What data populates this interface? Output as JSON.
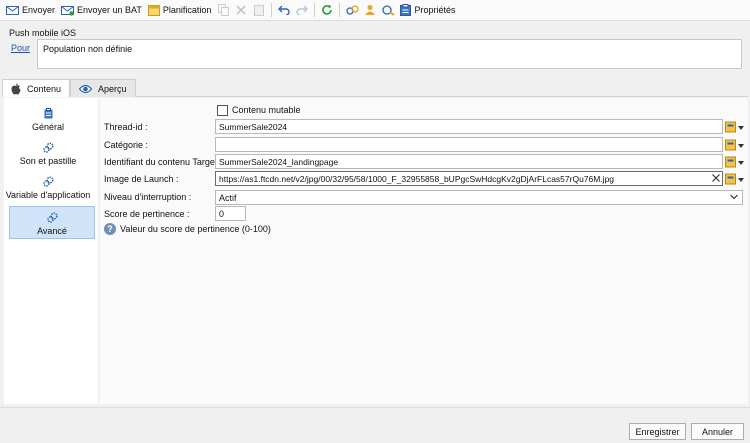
{
  "toolbar": {
    "send_label": "Envoyer",
    "send_bat_label": "Envoyer un BAT",
    "schedule_label": "Planification",
    "properties_label": "Propriétés"
  },
  "header": {
    "section_title": "Push mobile iOS",
    "pour_label": "Pour",
    "population_text": "Population non définie"
  },
  "tabs": [
    {
      "label": "Contenu"
    },
    {
      "label": "Aperçu"
    }
  ],
  "sidebar": {
    "items": [
      {
        "label": "Général"
      },
      {
        "label": "Son et pastille"
      },
      {
        "label": "Variable d'application"
      },
      {
        "label": "Avancé"
      }
    ]
  },
  "form": {
    "mutable_label": "Contenu mutable",
    "thread_id_label": "Thread-id :",
    "thread_id_value": "SummerSale2024",
    "category_label": "Catégorie :",
    "category_value": "",
    "target_id_label": "Identifiant du contenu Target :",
    "target_id_value": "SummerSale2024_landingpage",
    "launch_image_label": "Image de Launch :",
    "launch_image_value": "https://as1.ftcdn.net/v2/jpg/00/32/95/58/1000_F_32955858_bUPgcSwHdcgKv2gDjArFLcas57rQu76M.jpg",
    "interruption_label": "Niveau d'interruption :",
    "interruption_value": "Actif",
    "relevance_label": "Score de pertinence :",
    "relevance_value": "0",
    "relevance_help": "Valeur du score de pertinence (0-100)"
  },
  "footer": {
    "save_label": "Enregistrer",
    "cancel_label": "Annuler"
  },
  "colors": {
    "accent": "#1a73c8",
    "link": "#1a4fb5",
    "selected_bg": "#cfe4f8"
  }
}
